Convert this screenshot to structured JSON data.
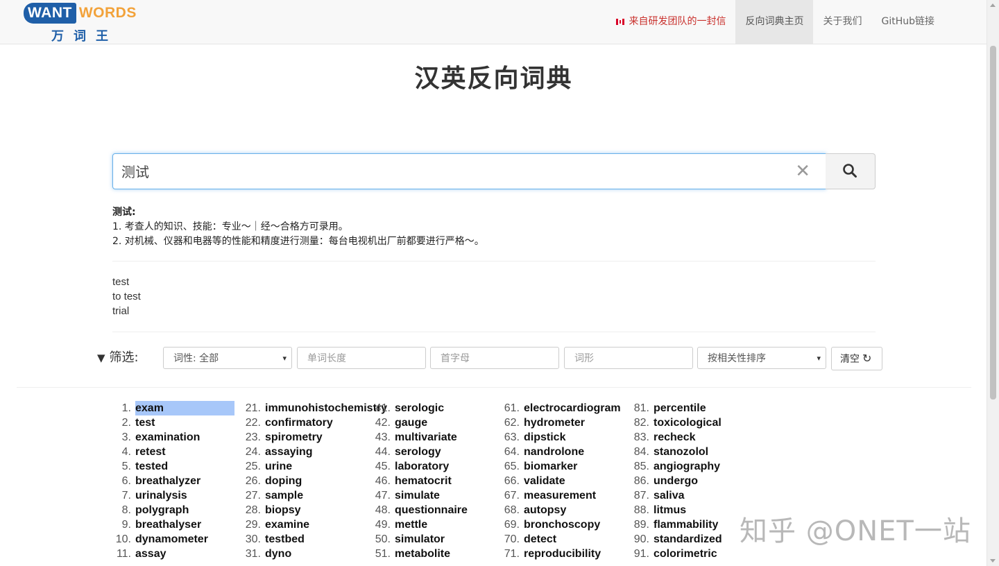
{
  "logo": {
    "want": "WANT",
    "words": "WORDS",
    "cn": "万词王"
  },
  "nav": {
    "letter": "来自研发团队的一封信",
    "home": "反向词典主页",
    "about": "关于我们",
    "github": "GitHub链接"
  },
  "page_title": "汉英反向词典",
  "search": {
    "value": "测试"
  },
  "definition": {
    "word": "测试:",
    "lines": [
      "1. 考查人的知识、技能：专业～｜经～合格方可录用。",
      "2. 对机械、仪器和电器等的性能和精度进行测量：每台电视机出厂前都要进行严格～。"
    ]
  },
  "translations": [
    "test",
    "to test",
    "trial"
  ],
  "filters": {
    "label": "筛选:",
    "pos": "词性: 全部",
    "length_placeholder": "单词长度",
    "initial_placeholder": "首字母",
    "form_placeholder": "词形",
    "sort": "按相关性排序",
    "clear": "清空"
  },
  "results": [
    [
      {
        "n": "1.",
        "w": "exam"
      },
      {
        "n": "2.",
        "w": "test"
      },
      {
        "n": "3.",
        "w": "examination"
      },
      {
        "n": "4.",
        "w": "retest"
      },
      {
        "n": "5.",
        "w": "tested"
      },
      {
        "n": "6.",
        "w": "breathalyzer"
      },
      {
        "n": "7.",
        "w": "urinalysis"
      },
      {
        "n": "8.",
        "w": "polygraph"
      },
      {
        "n": "9.",
        "w": "breathalyser"
      },
      {
        "n": "10.",
        "w": "dynamometer"
      },
      {
        "n": "11.",
        "w": "assay"
      }
    ],
    [
      {
        "n": "21.",
        "w": "immunohistochemistry"
      },
      {
        "n": "22.",
        "w": "confirmatory"
      },
      {
        "n": "23.",
        "w": "spirometry"
      },
      {
        "n": "24.",
        "w": "assaying"
      },
      {
        "n": "25.",
        "w": "urine"
      },
      {
        "n": "26.",
        "w": "doping"
      },
      {
        "n": "27.",
        "w": "sample"
      },
      {
        "n": "28.",
        "w": "biopsy"
      },
      {
        "n": "29.",
        "w": "examine"
      },
      {
        "n": "30.",
        "w": "testbed"
      },
      {
        "n": "31.",
        "w": "dyno"
      }
    ],
    [
      {
        "n": "41.",
        "w": "serologic"
      },
      {
        "n": "42.",
        "w": "gauge"
      },
      {
        "n": "43.",
        "w": "multivariate"
      },
      {
        "n": "44.",
        "w": "serology"
      },
      {
        "n": "45.",
        "w": "laboratory"
      },
      {
        "n": "46.",
        "w": "hematocrit"
      },
      {
        "n": "47.",
        "w": "simulate"
      },
      {
        "n": "48.",
        "w": "questionnaire"
      },
      {
        "n": "49.",
        "w": "mettle"
      },
      {
        "n": "50.",
        "w": "simulator"
      },
      {
        "n": "51.",
        "w": "metabolite"
      }
    ],
    [
      {
        "n": "61.",
        "w": "electrocardiogram"
      },
      {
        "n": "62.",
        "w": "hydrometer"
      },
      {
        "n": "63.",
        "w": "dipstick"
      },
      {
        "n": "64.",
        "w": "nandrolone"
      },
      {
        "n": "65.",
        "w": "biomarker"
      },
      {
        "n": "66.",
        "w": "validate"
      },
      {
        "n": "67.",
        "w": "measurement"
      },
      {
        "n": "68.",
        "w": "autopsy"
      },
      {
        "n": "69.",
        "w": "bronchoscopy"
      },
      {
        "n": "70.",
        "w": "detect"
      },
      {
        "n": "71.",
        "w": "reproducibility"
      }
    ],
    [
      {
        "n": "81.",
        "w": "percentile"
      },
      {
        "n": "82.",
        "w": "toxicological"
      },
      {
        "n": "83.",
        "w": "recheck"
      },
      {
        "n": "84.",
        "w": "stanozolol"
      },
      {
        "n": "85.",
        "w": "angiography"
      },
      {
        "n": "86.",
        "w": "undergo"
      },
      {
        "n": "87.",
        "w": "saliva"
      },
      {
        "n": "88.",
        "w": "litmus"
      },
      {
        "n": "89.",
        "w": "flammability"
      },
      {
        "n": "90.",
        "w": "standardized"
      },
      {
        "n": "91.",
        "w": "colorimetric"
      }
    ]
  ],
  "watermark": "知乎 @ONET一站",
  "colors": {
    "highlight": "#a7c7f9",
    "brand_blue": "#1f5fa8",
    "brand_orange": "#f2a23a",
    "letter_red": "#c9302c"
  }
}
